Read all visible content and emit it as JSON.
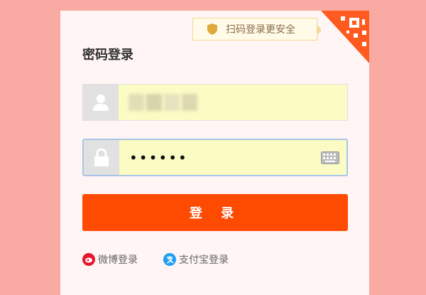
{
  "panel": {
    "title": "密码登录",
    "qr_tip": "扫码登录更安全"
  },
  "fields": {
    "username_value": "",
    "password_value": "••••••"
  },
  "login_button": "登 录",
  "social": {
    "weibo_label": "微博登录",
    "alipay_label": "支付宝登录"
  },
  "colors": {
    "accent": "#ff4a02",
    "page_bg": "#f9aaa3",
    "field_bg": "#fafcc4"
  },
  "icons": [
    "shield-icon",
    "qr-code-icon",
    "user-icon",
    "lock-icon",
    "keyboard-icon",
    "weibo-icon",
    "alipay-icon"
  ]
}
